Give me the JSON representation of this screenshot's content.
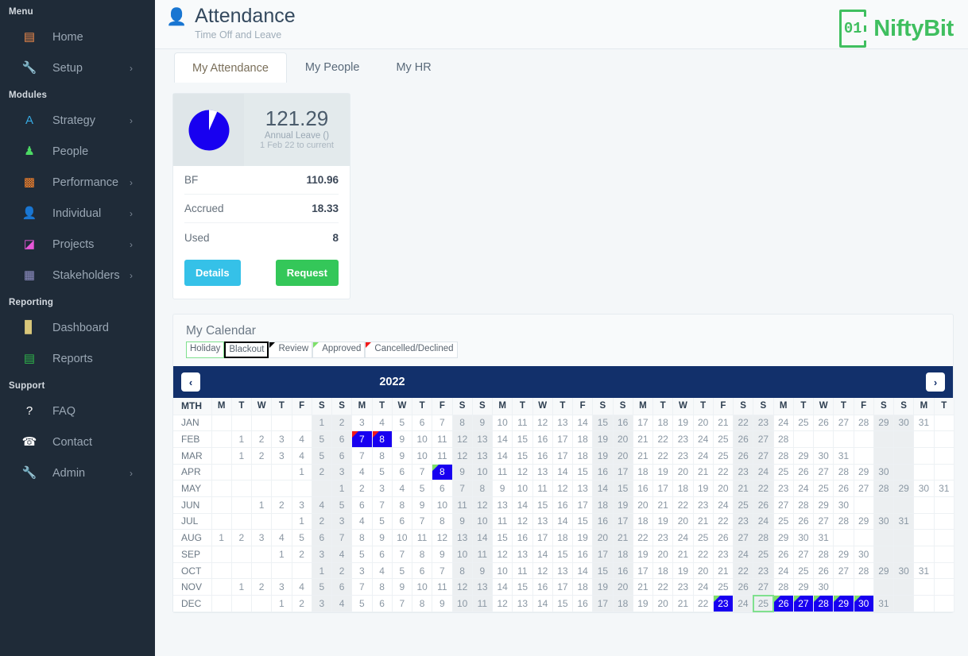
{
  "sidebar": {
    "sections": [
      {
        "label": "Menu",
        "items": [
          {
            "label": "Home",
            "icon": "server-icon",
            "glyph": "▤",
            "color": "#f08a4b",
            "arrow": false
          },
          {
            "label": "Setup",
            "icon": "wrench-icon",
            "glyph": "🔧",
            "color": "#e05c5c",
            "arrow": true
          }
        ]
      },
      {
        "label": "Modules",
        "items": [
          {
            "label": "Strategy",
            "icon": "chart-icon",
            "glyph": "A",
            "color": "#36a9e1",
            "arrow": true
          },
          {
            "label": "People",
            "icon": "people-icon",
            "glyph": "♟",
            "color": "#4cd964",
            "arrow": false
          },
          {
            "label": "Performance",
            "icon": "gauge-icon",
            "glyph": "▩",
            "color": "#f5822c",
            "arrow": true
          },
          {
            "label": "Individual",
            "icon": "person-icon",
            "glyph": "👤",
            "color": "#f5c518",
            "arrow": true
          },
          {
            "label": "Projects",
            "icon": "box-icon",
            "glyph": "◪",
            "color": "#e857d8",
            "arrow": true
          },
          {
            "label": "Stakeholders",
            "icon": "group-icon",
            "glyph": "▦",
            "color": "#8f8fc4",
            "arrow": true
          }
        ]
      },
      {
        "label": "Reporting",
        "items": [
          {
            "label": "Dashboard",
            "icon": "bar-chart-icon",
            "glyph": "▊",
            "color": "#d9c77a",
            "arrow": false
          },
          {
            "label": "Reports",
            "icon": "document-icon",
            "glyph": "▤",
            "color": "#2fb34a",
            "arrow": false
          }
        ]
      },
      {
        "label": "Support",
        "items": [
          {
            "label": "FAQ",
            "icon": "question-circle-icon",
            "glyph": "?",
            "color": "#ffffff",
            "arrow": false
          },
          {
            "label": "Contact",
            "icon": "phone-icon",
            "glyph": "☎",
            "color": "#ffffff",
            "arrow": false
          },
          {
            "label": "Admin",
            "icon": "wrench-icon",
            "glyph": "🔧",
            "color": "#3fbf5f",
            "arrow": true
          }
        ]
      }
    ]
  },
  "header": {
    "icon": "person-icon",
    "title": "Attendance",
    "subtitle": "Time Off and Leave",
    "brand_mark": "01",
    "brand_name": "NiftyBit",
    "brand_color": "#3fbf5f"
  },
  "tabs": [
    {
      "label": "My Attendance",
      "active": true
    },
    {
      "label": "My People",
      "active": false
    },
    {
      "label": "My HR",
      "active": false
    }
  ],
  "summary_card": {
    "figure": "121.29",
    "figure_label": "Annual Leave ()",
    "figure_period": "1 Feb 22 to current",
    "pie_color": "#1800f0",
    "pie_used_percent": 6.6,
    "rows": [
      {
        "label": "BF",
        "value": "110.96"
      },
      {
        "label": "Accrued",
        "value": "18.33"
      },
      {
        "label": "Used",
        "value": "8"
      }
    ],
    "details_button": "Details",
    "request_button": "Request"
  },
  "calendar": {
    "title": "My Calendar",
    "legend": [
      {
        "label": "Holiday",
        "style": "holiday"
      },
      {
        "label": "Blackout",
        "style": "blackout"
      },
      {
        "label": "Review",
        "style": "review",
        "corner": "#000000"
      },
      {
        "label": "Approved",
        "style": "approved",
        "corner": "#7ee06a"
      },
      {
        "label": "Cancelled/Declined",
        "style": "cancel",
        "corner": "#f21a1a"
      }
    ],
    "year": "2022",
    "prev_label": "‹",
    "next_label": "›",
    "month_header": "MTH",
    "day_headers": [
      "M",
      "T",
      "W",
      "T",
      "F",
      "S",
      "S",
      "M",
      "T",
      "W",
      "T",
      "F",
      "S",
      "S",
      "M",
      "T",
      "W",
      "T",
      "F",
      "S",
      "S",
      "M",
      "T",
      "W",
      "T",
      "F",
      "S",
      "S",
      "M",
      "T",
      "W",
      "T",
      "F",
      "S",
      "S",
      "M",
      "T"
    ],
    "weekend_columns": [
      5,
      6,
      12,
      13,
      19,
      20,
      26,
      27,
      33,
      34
    ],
    "rows": [
      {
        "month": "JAN",
        "offset": 5,
        "days": 31
      },
      {
        "month": "FEB",
        "offset": 1,
        "days": 28
      },
      {
        "month": "MAR",
        "offset": 1,
        "days": 31
      },
      {
        "month": "APR",
        "offset": 4,
        "days": 30
      },
      {
        "month": "MAY",
        "offset": 6,
        "days": 31
      },
      {
        "month": "JUN",
        "offset": 2,
        "days": 30
      },
      {
        "month": "JUL",
        "offset": 4,
        "days": 31
      },
      {
        "month": "AUG",
        "offset": 0,
        "days": 31
      },
      {
        "month": "SEP",
        "offset": 3,
        "days": 30
      },
      {
        "month": "OCT",
        "offset": 5,
        "days": 31
      },
      {
        "month": "NOV",
        "offset": 1,
        "days": 30
      },
      {
        "month": "DEC",
        "offset": 3,
        "days": 31
      }
    ],
    "marks": [
      {
        "month": "FEB",
        "day": 7,
        "selected": true,
        "flag": "cancel"
      },
      {
        "month": "FEB",
        "day": 8,
        "selected": true,
        "flag": "cancel"
      },
      {
        "month": "APR",
        "day": 8,
        "selected": true,
        "flag": "approved"
      },
      {
        "month": "DEC",
        "day": 23,
        "selected": true,
        "flag": "approved"
      },
      {
        "month": "DEC",
        "day": 25,
        "selected": false,
        "holiday": true
      },
      {
        "month": "DEC",
        "day": 26,
        "selected": true,
        "flag": "approved"
      },
      {
        "month": "DEC",
        "day": 27,
        "selected": true,
        "flag": "approved"
      },
      {
        "month": "DEC",
        "day": 28,
        "selected": true,
        "flag": "approved"
      },
      {
        "month": "DEC",
        "day": 29,
        "selected": true,
        "flag": "approved"
      },
      {
        "month": "DEC",
        "day": 30,
        "selected": true,
        "flag": "approved"
      }
    ]
  }
}
